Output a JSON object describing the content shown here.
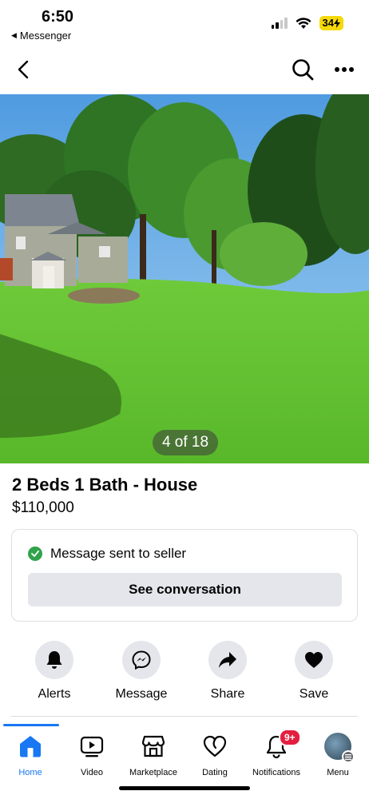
{
  "status_bar": {
    "time": "6:50",
    "back_app": "Messenger",
    "battery": "34"
  },
  "photo": {
    "counter": "4 of 18"
  },
  "listing": {
    "title": "2 Beds 1 Bath - House",
    "price": "$110,000"
  },
  "message_card": {
    "status": "Message sent to seller",
    "button": "See conversation"
  },
  "actions": [
    {
      "label": "Alerts",
      "icon": "bell-icon"
    },
    {
      "label": "Message",
      "icon": "messenger-icon"
    },
    {
      "label": "Share",
      "icon": "share-icon"
    },
    {
      "label": "Save",
      "icon": "heart-icon"
    }
  ],
  "tabs": [
    {
      "label": "Home",
      "icon": "home-icon",
      "active": true
    },
    {
      "label": "Video",
      "icon": "video-icon"
    },
    {
      "label": "Marketplace",
      "icon": "marketplace-icon"
    },
    {
      "label": "Dating",
      "icon": "dating-icon"
    },
    {
      "label": "Notifications",
      "icon": "bell-icon",
      "badge": "9+"
    },
    {
      "label": "Menu",
      "icon": "avatar"
    }
  ],
  "colors": {
    "accent": "#1877f2",
    "success": "#31a24c",
    "badge": "#e41e3f"
  }
}
